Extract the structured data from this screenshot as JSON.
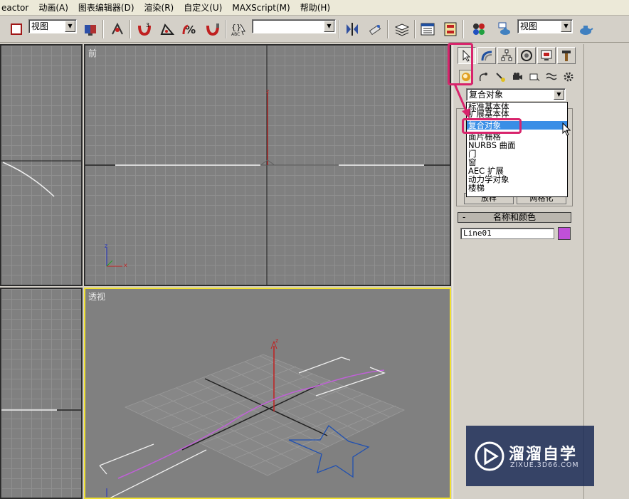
{
  "menu": {
    "items": [
      "eactor",
      "动画(A)",
      "图表编辑器(D)",
      "渲染(R)",
      "自定义(U)",
      "MAXScript(M)",
      "帮助(H)"
    ]
  },
  "toolbar": {
    "view_combo_1": "视图",
    "view_combo_2": "视图",
    "selection_set_combo": ""
  },
  "viewports": {
    "front": {
      "label": "前"
    },
    "perspective": {
      "label": "透视"
    },
    "axis_z": "z",
    "axis_x": "x"
  },
  "command_panel": {
    "category_combo": "复合对象",
    "dropdown_options": [
      "标准基本体",
      "扩展基本体",
      "复合对象",
      "面片栅格",
      "NURBS 曲面",
      "门",
      "窗",
      "AEC 扩展",
      "动力学对象",
      "楼梯"
    ],
    "selected_option": "复合对象",
    "hidden_button_1": "放样",
    "hidden_button_2": "网格化",
    "rollout_name_color": "名称和颜色",
    "rollout_minus": "-",
    "object_name": "Line01",
    "object_color": "#c050d8"
  },
  "colors": {
    "highlight": "#d8246c",
    "active_viewport": "#f0e030",
    "selection_blue": "#3a8ee6"
  },
  "watermark": {
    "title": "溜溜自学",
    "subtitle": "ZIXUE.3D66.COM"
  }
}
